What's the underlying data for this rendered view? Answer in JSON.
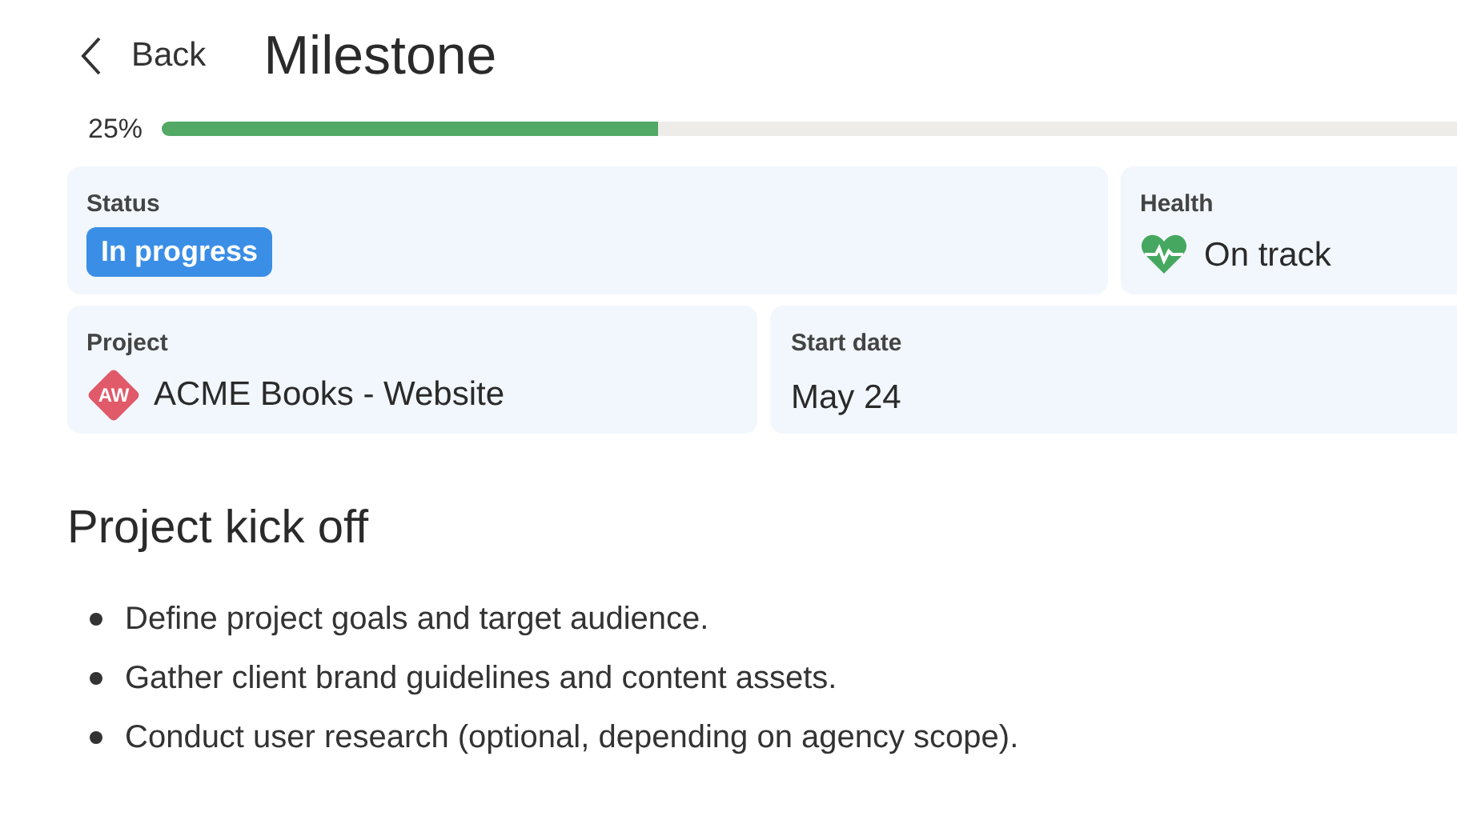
{
  "header": {
    "back": "Back",
    "title": "Milestone"
  },
  "progress": {
    "reading": "25%",
    "level": 0.25
  },
  "status": {
    "label": "Status",
    "value": "In progress"
  },
  "health": {
    "label": "Health",
    "value": "On track"
  },
  "project": {
    "label": "Project",
    "initials": "AW",
    "value": "ACME Books - Website"
  },
  "start_date": {
    "label": "Start date",
    "value": "May 24"
  },
  "section": {
    "title": "Project kick off",
    "items": [
      "Define project goals and target audience.",
      "Gather client brand guidelines and content assets.",
      "Conduct user research (optional, depending on agency scope)."
    ]
  }
}
